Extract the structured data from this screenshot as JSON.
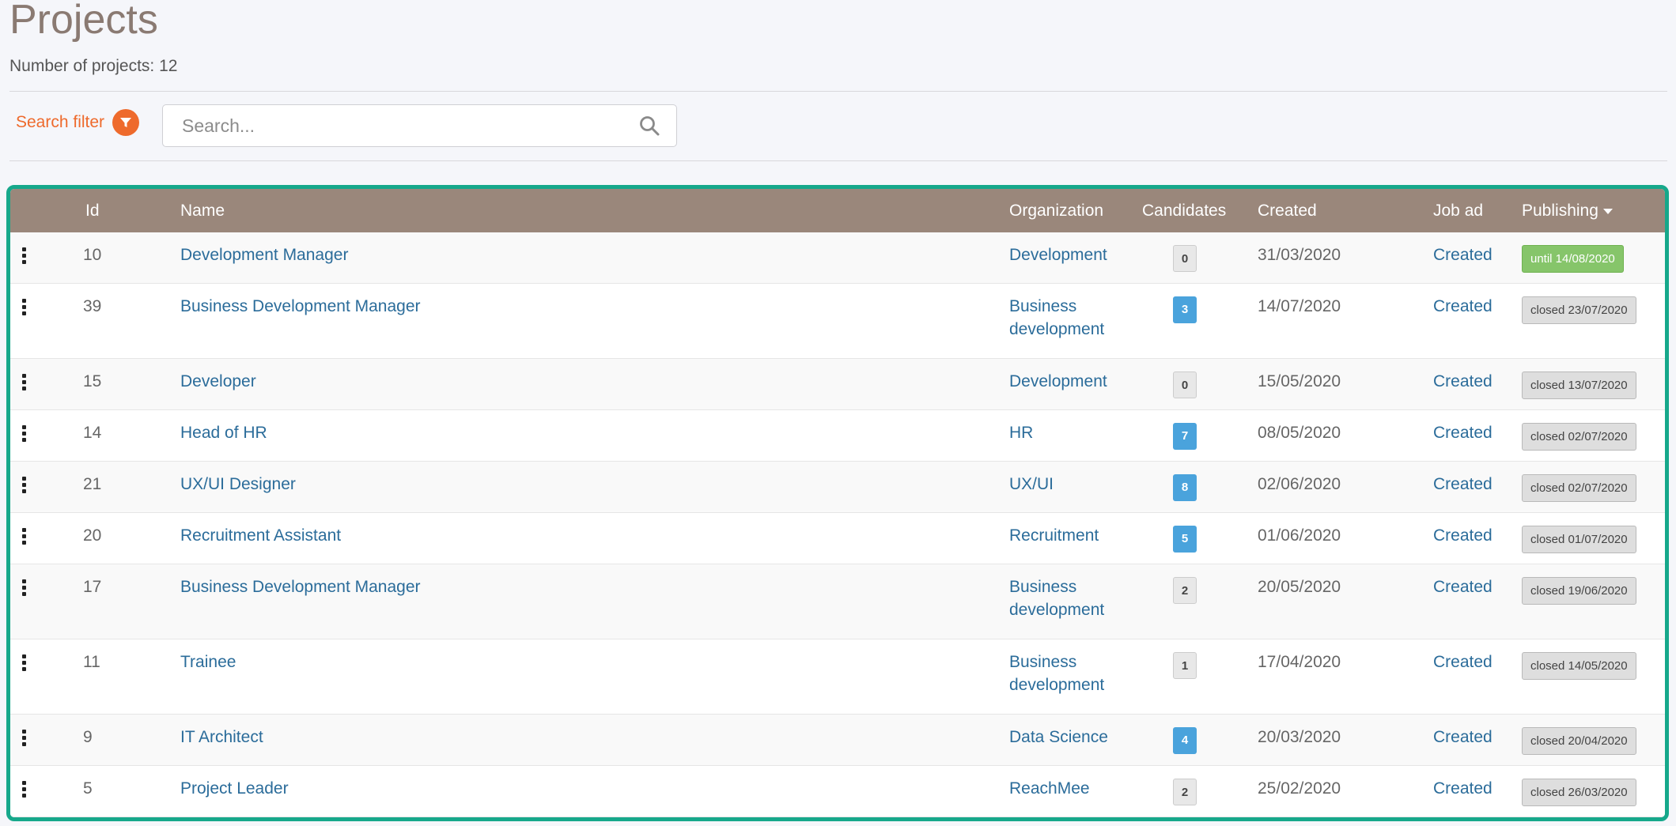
{
  "page": {
    "title": "Projects",
    "count_text": "Number of projects: 12"
  },
  "filter": {
    "label": "Search filter",
    "search_placeholder": "Search..."
  },
  "table": {
    "headers": {
      "id": "Id",
      "name": "Name",
      "organization": "Organization",
      "candidates": "Candidates",
      "created": "Created",
      "job_ad": "Job ad",
      "publishing": "Publishing"
    },
    "rows": [
      {
        "id": "10",
        "name": "Development Manager",
        "org_line1": "Development",
        "org_line2": "",
        "candidates": "0",
        "created": "31/03/2020",
        "job_ad": "Created",
        "publishing": "until 14/08/2020",
        "pub_status": "active"
      },
      {
        "id": "39",
        "name": "Business Development Manager",
        "org_line1": "Business",
        "org_line2": "development",
        "candidates": "3",
        "created": "14/07/2020",
        "job_ad": "Created",
        "publishing": "closed 23/07/2020",
        "pub_status": "closed"
      },
      {
        "id": "15",
        "name": "Developer",
        "org_line1": "Development",
        "org_line2": "",
        "candidates": "0",
        "created": "15/05/2020",
        "job_ad": "Created",
        "publishing": "closed 13/07/2020",
        "pub_status": "closed"
      },
      {
        "id": "14",
        "name": "Head of HR",
        "org_line1": "HR",
        "org_line2": "",
        "candidates": "7",
        "created": "08/05/2020",
        "job_ad": "Created",
        "publishing": "closed 02/07/2020",
        "pub_status": "closed"
      },
      {
        "id": "21",
        "name": "UX/UI Designer",
        "org_line1": "UX/UI",
        "org_line2": "",
        "candidates": "8",
        "created": "02/06/2020",
        "job_ad": "Created",
        "publishing": "closed 02/07/2020",
        "pub_status": "closed"
      },
      {
        "id": "20",
        "name": "Recruitment Assistant",
        "org_line1": "Recruitment",
        "org_line2": "",
        "candidates": "5",
        "created": "01/06/2020",
        "job_ad": "Created",
        "publishing": "closed 01/07/2020",
        "pub_status": "closed"
      },
      {
        "id": "17",
        "name": "Business Development Manager",
        "org_line1": "Business",
        "org_line2": "development",
        "candidates": "2",
        "created": "20/05/2020",
        "job_ad": "Created",
        "publishing": "closed 19/06/2020",
        "pub_status": "closed"
      },
      {
        "id": "11",
        "name": "Trainee",
        "org_line1": "Business",
        "org_line2": "development",
        "candidates": "1",
        "created": "17/04/2020",
        "job_ad": "Created",
        "publishing": "closed 14/05/2020",
        "pub_status": "closed"
      },
      {
        "id": "9",
        "name": "IT Architect",
        "org_line1": "Data Science",
        "org_line2": "",
        "candidates": "4",
        "created": "20/03/2020",
        "job_ad": "Created",
        "publishing": "closed 20/04/2020",
        "pub_status": "closed"
      },
      {
        "id": "5",
        "name": "Project Leader",
        "org_line1": "ReachMee",
        "org_line2": "",
        "candidates": "2",
        "created": "25/02/2020",
        "job_ad": "Created",
        "publishing": "closed 26/03/2020",
        "pub_status": "closed"
      }
    ]
  },
  "colors": {
    "accent_orange": "#ee6a2c",
    "header_brown": "#9a877b",
    "frame_teal": "#16a88b",
    "link_blue": "#2b6c9a",
    "badge_blue": "#4aa3dc",
    "publish_green": "#86c56a"
  },
  "icons": {
    "filter": "funnel-icon",
    "search": "magnifier-icon",
    "row_menu": "vertical-dots-icon",
    "sort": "caret-down-icon"
  }
}
